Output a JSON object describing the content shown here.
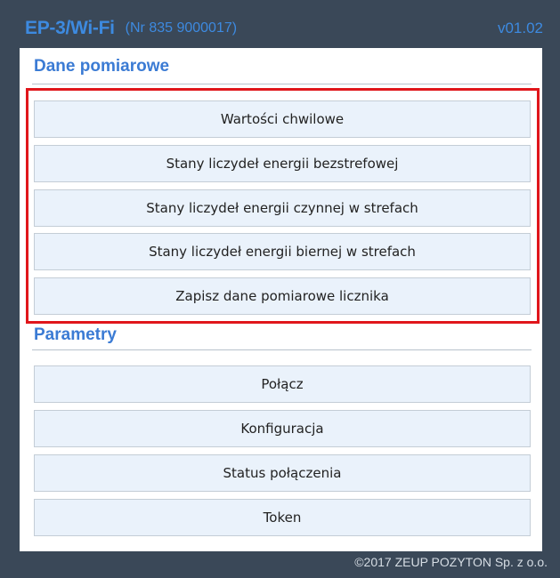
{
  "header": {
    "title": "EP-3/Wi-Fi",
    "serial": "(Nr 835 9000017)",
    "version": "v01.02"
  },
  "measurement_section": {
    "title": "Dane pomiarowe",
    "buttons": [
      "Wartości chwilowe",
      "Stany liczydeł energii bezstrefowej",
      "Stany liczydeł energii czynnej w strefach",
      "Stany liczydeł energii biernej w strefach",
      "Zapisz dane pomiarowe licznika"
    ]
  },
  "parameters_section": {
    "title": "Parametry",
    "buttons": [
      "Połącz",
      "Konfiguracja",
      "Status połączenia",
      "Token"
    ]
  },
  "footer": {
    "copyright": "©2017 ZEUP POZYTON Sp. z o.o."
  },
  "colors": {
    "frame": "#3a4858",
    "accent": "#3d8ae0",
    "button_bg": "#eaf2fb",
    "highlight": "#e0161b"
  }
}
